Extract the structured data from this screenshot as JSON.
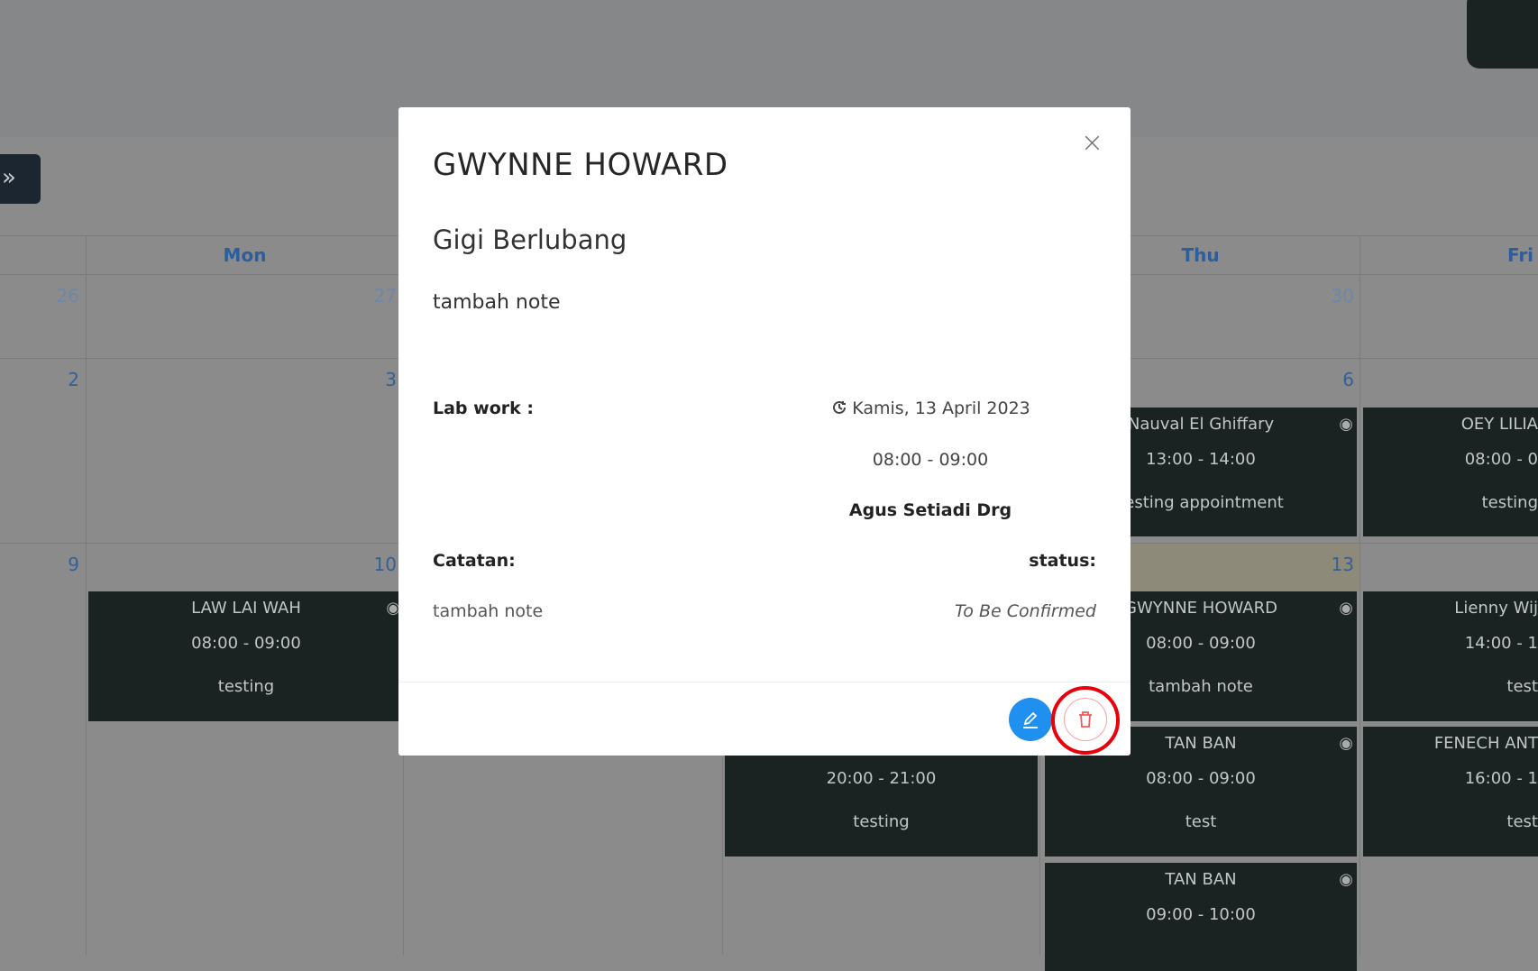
{
  "header": {
    "toggle_icon": "double-chevron-right-icon",
    "toggle_label": "»"
  },
  "calendar": {
    "days": [
      {
        "label": "Mon"
      },
      {
        "label": "Thu"
      },
      {
        "label": "Fri"
      }
    ],
    "day_numbers": {
      "r1": [
        "26",
        "27",
        "30"
      ],
      "r2": [
        "2",
        "3",
        "6"
      ],
      "r3": [
        "9",
        "10",
        "13"
      ]
    },
    "events": {
      "mon_law": {
        "title": "LAW LAI WAH",
        "time": "08:00 - 09:00",
        "note": "testing"
      },
      "wed_ev": {
        "time": "20:00 - 21:00",
        "note": "testing"
      },
      "thu_nauval": {
        "title": "Nauval El Ghiffary",
        "time": "13:00 - 14:00",
        "note": "testing appointment"
      },
      "thu_gwynne": {
        "title": "GWYNNE HOWARD",
        "time": "08:00 - 09:00",
        "note": "tambah note"
      },
      "thu_tan1": {
        "title": "TAN BAN",
        "time": "08:00 - 09:00",
        "note": "test"
      },
      "thu_tan2": {
        "title": "TAN BAN",
        "time": "09:00 - 10:00"
      },
      "fri_oey": {
        "title": "OEY LILIA",
        "time": "08:00 - 0",
        "note": "testing"
      },
      "fri_lienny": {
        "title": "Lienny Wij",
        "time": "14:00 - 1",
        "note": "test"
      },
      "fri_fenech": {
        "title": "FENECH ANT",
        "time": "16:00 - 1",
        "note": "test"
      }
    },
    "eye_icon": "◉"
  },
  "modal": {
    "title": "GWYNNE HOWARD",
    "subtitle": "Gigi Berlubang",
    "note": "tambah note",
    "lab_work_label": "Lab work :",
    "date": "Kamis, 13 April 2023",
    "time": "08:00 - 09:00",
    "doctor": "Agus Setiadi Drg",
    "catatan_label": "Catatan:",
    "catatan_value": "tambah note",
    "status_label": "status:",
    "status_value": "To Be Confirmed",
    "close_label": "×",
    "colors": {
      "edit": "#1f8ff0",
      "delete": "#f25c5c",
      "highlight": "#e8000b"
    }
  }
}
